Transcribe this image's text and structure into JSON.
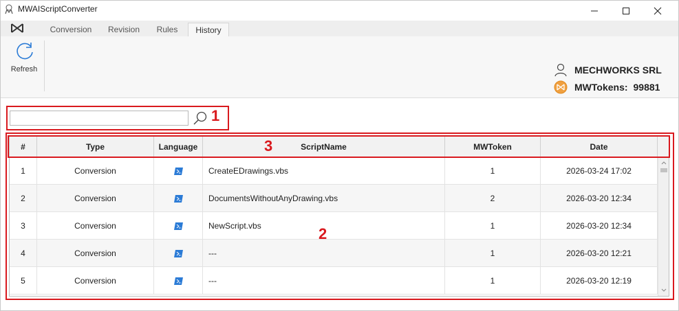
{
  "window": {
    "title": "MWAIScriptConverter"
  },
  "tabs": [
    {
      "label": "Conversion",
      "active": false
    },
    {
      "label": "Revision",
      "active": false
    },
    {
      "label": "Rules",
      "active": false
    },
    {
      "label": "History",
      "active": true
    }
  ],
  "ribbon": {
    "refresh_label": "Refresh"
  },
  "account": {
    "company": "MECHWORKS SRL",
    "tokens_label": "MWTokens:",
    "tokens_value": "99881"
  },
  "search": {
    "value": "",
    "placeholder": ""
  },
  "annotations": [
    "1",
    "2",
    "3"
  ],
  "grid": {
    "columns": [
      "#",
      "Type",
      "Language",
      "ScriptName",
      "MWToken",
      "Date"
    ],
    "rows": [
      {
        "num": "1",
        "type": "Conversion",
        "language": "powershell-icon",
        "script": "CreateEDrawings.vbs",
        "token": "1",
        "date": "2026-03-24 17:02"
      },
      {
        "num": "2",
        "type": "Conversion",
        "language": "powershell-icon",
        "script": "DocumentsWithoutAnyDrawing.vbs",
        "token": "2",
        "date": "2026-03-20 12:34"
      },
      {
        "num": "3",
        "type": "Conversion",
        "language": "powershell-icon",
        "script": "NewScript.vbs",
        "token": "1",
        "date": "2026-03-20 12:34"
      },
      {
        "num": "4",
        "type": "Conversion",
        "language": "powershell-icon",
        "script": "---",
        "token": "1",
        "date": "2026-03-20 12:21"
      },
      {
        "num": "5",
        "type": "Conversion",
        "language": "powershell-icon",
        "script": "---",
        "token": "1",
        "date": "2026-03-20 12:19"
      }
    ]
  },
  "colors": {
    "annotation": "#d9191e",
    "token_orange": "#f0a040",
    "accent_blue": "#2b7bd6"
  }
}
